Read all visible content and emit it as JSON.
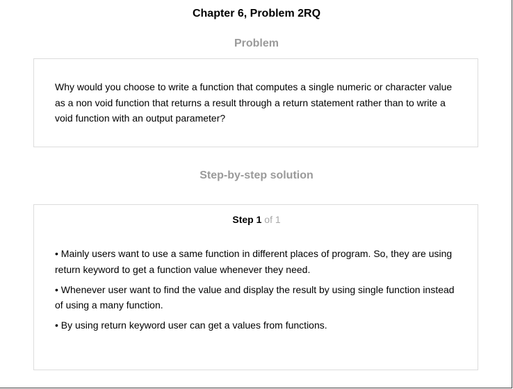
{
  "header": {
    "title": "Chapter 6, Problem 2RQ"
  },
  "problem": {
    "heading": "Problem",
    "text": "Why would you choose to write a function that computes a single numeric or character value as a non void function that returns a result through a return statement rather than to write a void function with an output parameter?"
  },
  "solution": {
    "heading": "Step-by-step solution",
    "step": {
      "word": "Step",
      "number": "1",
      "of_text": "of 1"
    },
    "bullets": [
      "• Mainly users want to use a same function in different places of program. So, they are using return keyword to get a function value whenever they need.",
      "• Whenever user want to find the value and display the result by using single function instead of using a many function.",
      "• By using return keyword user can get a values from functions."
    ]
  },
  "colors": {
    "heading_gray": "#9a9a9a",
    "card_border": "#dcdcdc",
    "muted_text": "#a8a8a8"
  }
}
